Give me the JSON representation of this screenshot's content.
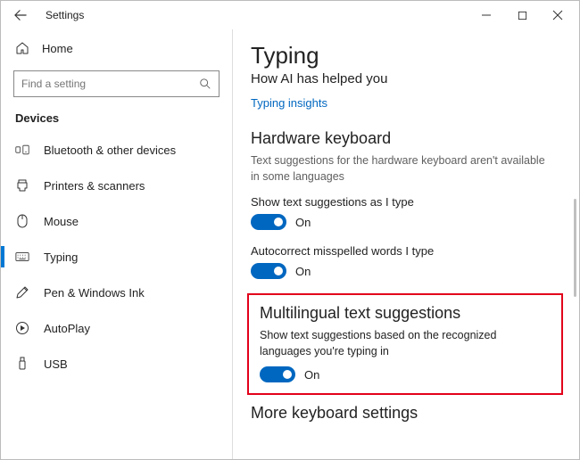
{
  "titlebar": {
    "title": "Settings"
  },
  "sidebar": {
    "home": "Home",
    "search_placeholder": "Find a setting",
    "group": "Devices",
    "items": [
      {
        "label": "Bluetooth & other devices"
      },
      {
        "label": "Printers & scanners"
      },
      {
        "label": "Mouse"
      },
      {
        "label": "Typing"
      },
      {
        "label": "Pen & Windows Ink"
      },
      {
        "label": "AutoPlay"
      },
      {
        "label": "USB"
      }
    ]
  },
  "main": {
    "title": "Typing",
    "subtitle": "How AI has helped you",
    "insights_link": "Typing insights",
    "hw": {
      "heading": "Hardware keyboard",
      "desc": "Text suggestions for the hardware keyboard aren't available in some languages",
      "s1": {
        "label": "Show text suggestions as I type",
        "state": "On"
      },
      "s2": {
        "label": "Autocorrect misspelled words I type",
        "state": "On"
      }
    },
    "ml": {
      "heading": "Multilingual text suggestions",
      "desc": "Show text suggestions based on the recognized languages you're typing in",
      "state": "On"
    },
    "more_heading": "More keyboard settings"
  },
  "colors": {
    "accent": "#0067c0",
    "highlight_border": "#e2001a"
  }
}
